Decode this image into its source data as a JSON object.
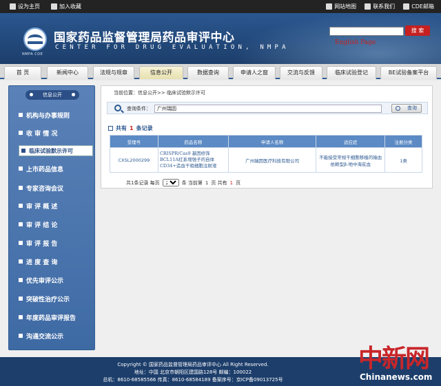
{
  "topbar": {
    "set_home": "设为主页",
    "add_favorite": "加入收藏",
    "site_map": "网站地图",
    "contact": "联系我们",
    "cde_mail": "CDE邮箱"
  },
  "header": {
    "title_cn": "国家药品监督管理局药品审评中心",
    "title_en": "CENTER FOR DRUG EVALUATION, NMPA",
    "logo_caption": "NMPA CDE",
    "search_button": "搜 索",
    "english_link": "English Page"
  },
  "nav": {
    "tabs": [
      {
        "label": "首 页"
      },
      {
        "label": "新闻中心"
      },
      {
        "label": "法规与规章"
      },
      {
        "label": "信息公开"
      },
      {
        "label": "数据查询"
      },
      {
        "label": "申请人之窗"
      },
      {
        "label": "交流与反馈"
      },
      {
        "label": "临床试验登记"
      },
      {
        "label": "BE试验备案平台"
      }
    ]
  },
  "sidebar": {
    "header": "信息公开",
    "items": [
      {
        "label": "机构与办事规则"
      },
      {
        "label": "收 审 情 况"
      },
      {
        "label": "临床试验默示许可"
      },
      {
        "label": "上市药品信息"
      },
      {
        "label": "专家咨询会议"
      },
      {
        "label": "审 评 概 述"
      },
      {
        "label": "审 评 结 论"
      },
      {
        "label": "审 评 报 告"
      },
      {
        "label": "进 度 查 询"
      },
      {
        "label": "优先审评公示"
      },
      {
        "label": "突破性治疗公示"
      },
      {
        "label": "年度药品审评报告"
      },
      {
        "label": "沟通交流公示"
      }
    ]
  },
  "content": {
    "breadcrumb": "当前位置：信息公开>> 临床试验默示许可",
    "query_label": "查询条件：",
    "query_value": "广州瑞因",
    "query_button": "查询",
    "count_prefix": "共有",
    "count_value": "1",
    "count_suffix": "条记录",
    "table": {
      "headers": [
        "受理号",
        "药品名称",
        "申请人名称",
        "适应症",
        "注册分类"
      ],
      "rows": [
        [
          "CXSL2000299",
          "CRISPR/Cas9 基因修饰BCL11A红系增强子的自体CD34+造血干祖细胞注射液",
          "广州瑞因医疗科技有限公司",
          "不能接受常规干细胞移植的输血依赖型β-地中海贫血",
          "1类"
        ]
      ]
    },
    "pager": {
      "total": "共1条记录 每页",
      "per_page": "20",
      "unit": "条 当前第",
      "current": "1",
      "of": "页 共有",
      "pages": "1",
      "end": "页"
    }
  },
  "footer": {
    "line1": "Copyright © 国家药品监督管理局药品审评中心  All Right Reserved.",
    "line2": "地址：中国 北京市朝阳区建国路128号  邮编：100022",
    "line3": "总机：8610-68585566  传真：8610-68584189  备案序号：京ICP备09013725号"
  },
  "watermark": {
    "cn": "中新网",
    "en": "Chinanews.com"
  }
}
